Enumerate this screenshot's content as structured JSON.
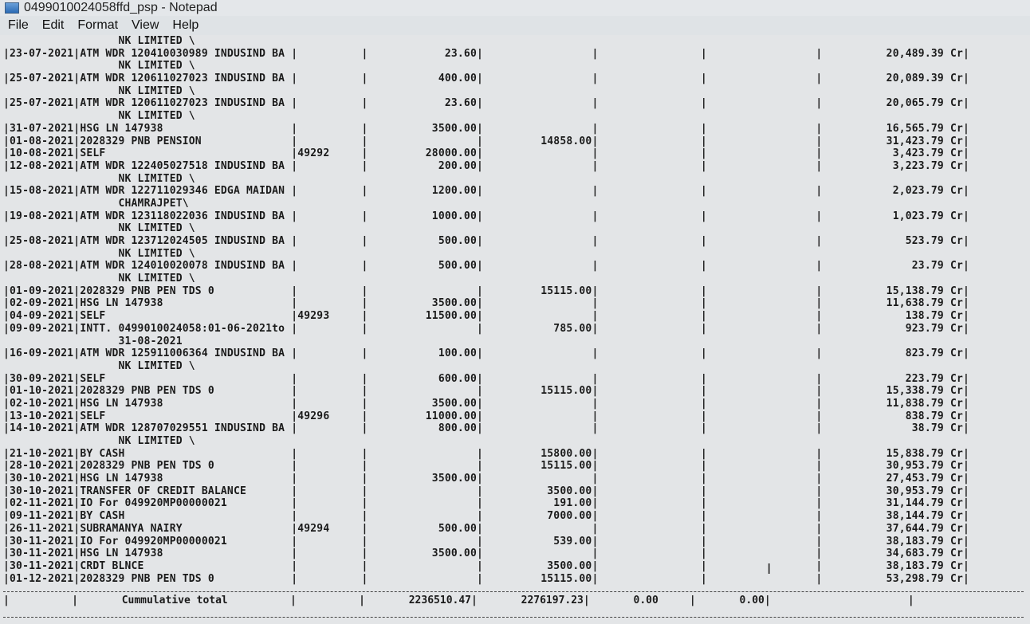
{
  "window": {
    "title": "0499010024058ffd_psp - Notepad",
    "icon": "notepad-icon"
  },
  "menu": [
    "File",
    "Edit",
    "Format",
    "View",
    "Help"
  ],
  "lines": [
    "                  NK LIMITED \\",
    "|23-07-2021|ATM WDR 120410030989 INDUSIND BA |          |            23.60|                 |                |                 |          20,489.39 Cr|",
    "                  NK LIMITED \\",
    "|25-07-2021|ATM WDR 120611027023 INDUSIND BA |          |           400.00|                 |                |                 |          20,089.39 Cr|",
    "                  NK LIMITED \\",
    "|25-07-2021|ATM WDR 120611027023 INDUSIND BA |          |            23.60|                 |                |                 |          20,065.79 Cr|",
    "                  NK LIMITED \\",
    "|31-07-2021|HSG LN 147938                    |          |          3500.00|                 |                |                 |          16,565.79 Cr|",
    "|01-08-2021|2028329 PNB PENSION              |          |                 |         14858.00|                |                 |          31,423.79 Cr|",
    "|10-08-2021|SELF                             |49292     |         28000.00|                 |                |                 |           3,423.79 Cr|",
    "|12-08-2021|ATM WDR 122405027518 INDUSIND BA |          |           200.00|                 |                |                 |           3,223.79 Cr|",
    "                  NK LIMITED \\",
    "|15-08-2021|ATM WDR 122711029346 EDGA MAIDAN |          |          1200.00|                 |                |                 |           2,023.79 Cr|",
    "                  CHAMRAJPET\\",
    "|19-08-2021|ATM WDR 123118022036 INDUSIND BA |          |          1000.00|                 |                |                 |           1,023.79 Cr|",
    "                  NK LIMITED \\",
    "|25-08-2021|ATM WDR 123712024505 INDUSIND BA |          |           500.00|                 |                |                 |             523.79 Cr|",
    "                  NK LIMITED \\",
    "|28-08-2021|ATM WDR 124010020078 INDUSIND BA |          |           500.00|                 |                |                 |              23.79 Cr|",
    "                  NK LIMITED \\",
    "|01-09-2021|2028329 PNB PEN TDS 0            |          |                 |         15115.00|                |                 |          15,138.79 Cr|",
    "|02-09-2021|HSG LN 147938                    |          |          3500.00|                 |                |                 |          11,638.79 Cr|",
    "|04-09-2021|SELF                             |49293     |         11500.00|                 |                |                 |             138.79 Cr|",
    "|09-09-2021|INTT. 0499010024058:01-06-2021to |          |                 |           785.00|                |                 |             923.79 Cr|",
    "                  31-08-2021",
    "|16-09-2021|ATM WDR 125911006364 INDUSIND BA |          |           100.00|                 |                |                 |             823.79 Cr|",
    "                  NK LIMITED \\",
    "|30-09-2021|SELF                             |          |           600.00|                 |                |                 |             223.79 Cr|",
    "|01-10-2021|2028329 PNB PEN TDS 0            |          |                 |         15115.00|                |                 |          15,338.79 Cr|",
    "|02-10-2021|HSG LN 147938                    |          |          3500.00|                 |                |                 |          11,838.79 Cr|",
    "|13-10-2021|SELF                             |49296     |         11000.00|                 |                |                 |             838.79 Cr|",
    "|14-10-2021|ATM WDR 128707029551 INDUSIND BA |          |           800.00|                 |                |                 |              38.79 Cr|",
    "                  NK LIMITED \\",
    "|21-10-2021|BY CASH                          |          |                 |         15800.00|                |                 |          15,838.79 Cr|",
    "|28-10-2021|2028329 PNB PEN TDS 0            |          |                 |         15115.00|                |                 |          30,953.79 Cr|",
    "|30-10-2021|HSG LN 147938                    |          |          3500.00|                 |                |                 |          27,453.79 Cr|",
    "|30-10-2021|TRANSFER OF CREDIT BALANCE       |          |                 |          3500.00|                |                 |          30,953.79 Cr|",
    "|02-11-2021|IO For 049920MP00000021          |          |                 |           191.00|                |                 |          31,144.79 Cr|",
    "|09-11-2021|BY CASH                          |          |                 |          7000.00|                |                 |          38,144.79 Cr|",
    "|26-11-2021|SUBRAMANYA NAIRY                 |49294     |           500.00|                 |                |                 |          37,644.79 Cr|",
    "|30-11-2021|IO For 049920MP00000021          |          |                 |           539.00|                |                 |          38,183.79 Cr|",
    "|30-11-2021|HSG LN 147938                    |          |          3500.00|                 |                |                 |          34,683.79 Cr|",
    "|30-11-2021|CRDT BLNCE                       |          |                 |          3500.00|                |                 |          38,183.79 Cr|",
    "|01-12-2021|2028329 PNB PEN TDS 0            |          |                 |         15115.00|                |                 |          53,298.79 Cr|"
  ],
  "total_row": "|          |       Cummulative total          |          |       2236510.47|       2276197.23|       0.00     |       0.00|                      |"
}
